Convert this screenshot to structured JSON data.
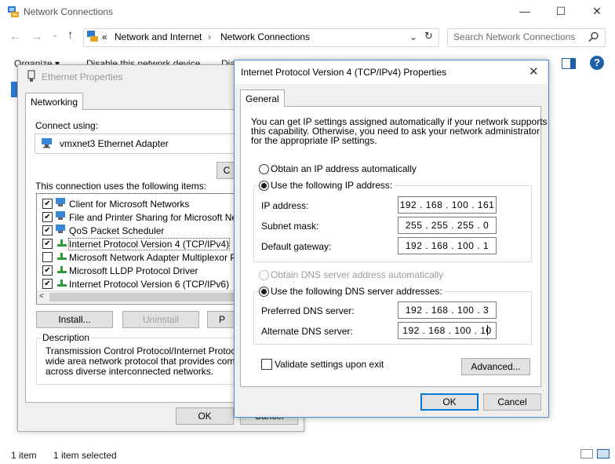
{
  "explorer": {
    "title": "Network Connections",
    "breadcrumb_prefix": "«",
    "breadcrumb_1": "Network and Internet",
    "breadcrumb_sep": "›",
    "breadcrumb_2": "Network Connections",
    "search_placeholder": "Search Network Connections",
    "cmd_organize": "Organize ▾",
    "cmd_disable": "Disable this network device",
    "cmd_diagnose": "Dia",
    "status_items": "1 item",
    "status_selected": "1 item selected"
  },
  "ethernet": {
    "title": "Ethernet Properties",
    "tab": "Networking",
    "connect_using": "Connect using:",
    "adapter": "vmxnet3 Ethernet Adapter",
    "configure_btn": "C",
    "items_label": "This connection uses the following items:",
    "items": [
      {
        "label": "Client for Microsoft Networks",
        "checked": true
      },
      {
        "label": "File and Printer Sharing for Microsoft Network",
        "checked": true
      },
      {
        "label": "QoS Packet Scheduler",
        "checked": true
      },
      {
        "label": "Internet Protocol Version 4 (TCP/IPv4)",
        "checked": true
      },
      {
        "label": "Microsoft Network Adapter Multiplexor Protoc",
        "checked": false
      },
      {
        "label": "Microsoft LLDP Protocol Driver",
        "checked": true
      },
      {
        "label": "Internet Protocol Version 6 (TCP/IPv6)",
        "checked": true
      }
    ],
    "install_btn": "Install...",
    "uninstall_btn": "Uninstall",
    "properties_btn": "P",
    "description_label": "Description",
    "description_text_1": "Transmission Control Protocol/Internet Protocol. Th",
    "description_text_2": "wide area network protocol that provides communic",
    "description_text_3": "across diverse interconnected networks.",
    "ok_btn": "OK",
    "cancel_btn": "Cancel"
  },
  "ipv4": {
    "title": "Internet Protocol Version 4 (TCP/IPv4) Properties",
    "close": "✕",
    "tab": "General",
    "intro_1": "You can get IP settings assigned automatically if your network supports",
    "intro_2": "this capability. Otherwise, you need to ask your network administrator",
    "intro_3": "for the appropriate IP settings.",
    "radio_auto_ip": "Obtain an IP address automatically",
    "radio_manual_ip": "Use the following IP address:",
    "ip_label": "IP address:",
    "ip_value": "192 . 168 . 100 . 161",
    "mask_label": "Subnet mask:",
    "mask_value": "255 . 255 . 255 .  0",
    "gateway_label": "Default gateway:",
    "gateway_value": "192 . 168 . 100 .  1",
    "radio_auto_dns": "Obtain DNS server address automatically",
    "radio_manual_dns": "Use the following DNS server addresses:",
    "pref_dns_label": "Preferred DNS server:",
    "pref_dns_value": "192 . 168 . 100 .  3",
    "alt_dns_label": "Alternate DNS server:",
    "alt_dns_value": "192 . 168 . 100 .  10",
    "validate_label": "Validate settings upon exit",
    "advanced_btn": "Advanced...",
    "ok_btn": "OK",
    "cancel_btn": "Cancel"
  }
}
